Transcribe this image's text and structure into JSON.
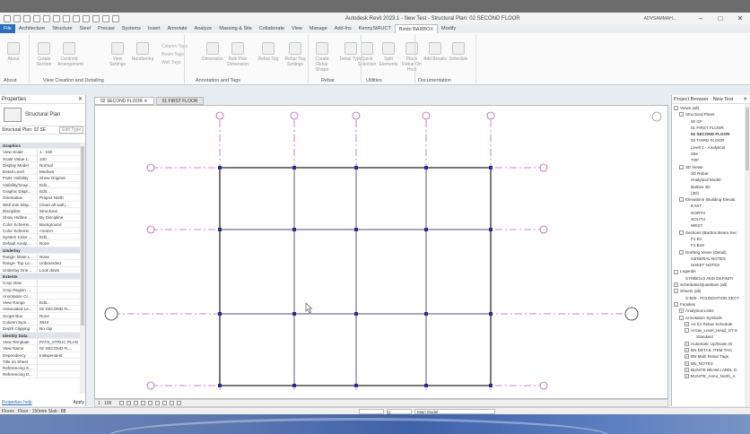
{
  "window": {
    "title": "Autodesk Revit 2023.1 - New Test - Structural Plan: 02 SECOND FLOOR",
    "user": "ADVSAMMAH..."
  },
  "tabs": [
    "File",
    "Architecture",
    "Structure",
    "Steel",
    "Precast",
    "Systems",
    "Insert",
    "Annotate",
    "Analyze",
    "Massing & Site",
    "Collaborate",
    "View",
    "Manage",
    "Add-Ins",
    "KennyStRUCT",
    "Bimbi BARBOX",
    "Modify"
  ],
  "ribbon": {
    "buttons": [
      "About",
      "Create Section",
      "Centroid Arrangement",
      "View Settings",
      "Numbering",
      "Dimension",
      "Bulk Plan Dimension",
      "Rebar Tag",
      "Rebar Tag Settings",
      "Create Rebar Shape",
      "Detail Type",
      "Quick Selection",
      "Split Elements",
      "Place Rebar On Host",
      "Add Breaks",
      "Schedule"
    ],
    "small": [
      "Column Tags",
      "Beam Tags",
      "Wall Tags"
    ],
    "panels": [
      "About",
      "View Creation and Detailing",
      "Annotation and Tags",
      "Rebar",
      "Utilities",
      "Documentation"
    ]
  },
  "properties": {
    "title": "Properties",
    "type": "Structural Plan",
    "selector": "Structural Plan: 02 SE",
    "edit_type": "Edit Type",
    "rows": [
      {
        "group": "Graphics"
      },
      {
        "k": "View Scale",
        "v": "1 : 100"
      },
      {
        "k": "Scale Value 1:",
        "v": "100"
      },
      {
        "k": "Display Model",
        "v": "Normal"
      },
      {
        "k": "Detail Level",
        "v": "Medium"
      },
      {
        "k": "Parts Visibility",
        "v": "Show Original"
      },
      {
        "k": "Visibility/Grap...",
        "v": "Edit..."
      },
      {
        "k": "Graphic Displ...",
        "v": "Edit..."
      },
      {
        "k": "Orientation",
        "v": "Project North"
      },
      {
        "k": "Wall Join Disp...",
        "v": "Clean all wall j..."
      },
      {
        "k": "Discipline",
        "v": "Structural"
      },
      {
        "k": "Show Hidden ...",
        "v": "By Discipline"
      },
      {
        "k": "Color Scheme...",
        "v": "Background"
      },
      {
        "k": "Color Scheme",
        "v": "<none>"
      },
      {
        "k": "System Color ...",
        "v": "Edit..."
      },
      {
        "k": "Default Analy...",
        "v": "None"
      },
      {
        "group": "Underlay"
      },
      {
        "k": "Range: Base L...",
        "v": "None"
      },
      {
        "k": "Range: Top Le...",
        "v": "Unbounded"
      },
      {
        "k": "Underlay Orie...",
        "v": "Look down"
      },
      {
        "group": "Extents"
      },
      {
        "k": "Crop View",
        "v": ""
      },
      {
        "k": "Crop Region ...",
        "v": ""
      },
      {
        "k": "Annotation Cr...",
        "v": ""
      },
      {
        "k": "View Range",
        "v": "Edit..."
      },
      {
        "k": "Associated Le...",
        "v": "02 SECOND FL..."
      },
      {
        "k": "Scope Box",
        "v": "None"
      },
      {
        "k": "Column Sym...",
        "v": "3843"
      },
      {
        "k": "Depth Clipping",
        "v": "No clip"
      },
      {
        "group": "Identity Data"
      },
      {
        "k": "View Template",
        "v": "PATS_STRUC PLAN"
      },
      {
        "k": "View Name",
        "v": "02 SECOND FL..."
      },
      {
        "k": "Dependency",
        "v": "Independent"
      },
      {
        "k": "Title on Sheet",
        "v": ""
      },
      {
        "k": "Referencing S...",
        "v": ""
      },
      {
        "k": "Referencing D...",
        "v": ""
      }
    ],
    "help": "Properties help",
    "apply": "Apply"
  },
  "view_tabs": [
    "02 SECOND FLOOR",
    "01 FIRST FLOOR"
  ],
  "view_strip": {
    "scale": "1 : 100"
  },
  "project_browser": {
    "title": "Project Browser - New Test",
    "items": [
      {
        "lvl": 0,
        "ex": "-",
        "t": "Views (all)"
      },
      {
        "lvl": 1,
        "ex": "-",
        "t": "Structural Plans"
      },
      {
        "lvl": 2,
        "ex": "",
        "t": "00 GF"
      },
      {
        "lvl": 2,
        "ex": "",
        "t": "01 FIRST FLOOR"
      },
      {
        "lvl": 2,
        "ex": "",
        "t": "02 SECOND FLOOR",
        "bold": true
      },
      {
        "lvl": 2,
        "ex": "",
        "t": "03 THIRD FLOOR"
      },
      {
        "lvl": 2,
        "ex": "",
        "t": "Level 1 - Analytical"
      },
      {
        "lvl": 2,
        "ex": "",
        "t": "Site"
      },
      {
        "lvl": 2,
        "ex": "",
        "t": "TOF"
      },
      {
        "lvl": 1,
        "ex": "-",
        "t": "3D Views"
      },
      {
        "lvl": 2,
        "ex": "",
        "t": "3D Rebar"
      },
      {
        "lvl": 2,
        "ex": "",
        "t": "Analytical Model"
      },
      {
        "lvl": 2,
        "ex": "",
        "t": "Barbox 3D"
      },
      {
        "lvl": 2,
        "ex": "",
        "t": "{3D}"
      },
      {
        "lvl": 1,
        "ex": "-",
        "t": "Elevations (Building Elevati"
      },
      {
        "lvl": 2,
        "ex": "",
        "t": "EAST"
      },
      {
        "lvl": 2,
        "ex": "",
        "t": "NORTH"
      },
      {
        "lvl": 2,
        "ex": "",
        "t": "SOUTH"
      },
      {
        "lvl": 2,
        "ex": "",
        "t": "WEST"
      },
      {
        "lvl": 1,
        "ex": "-",
        "t": "Sections (Barbox Beam Sec"
      },
      {
        "lvl": 2,
        "ex": "",
        "t": "F1.B1"
      },
      {
        "lvl": 2,
        "ex": "",
        "t": "F1.B18"
      },
      {
        "lvl": 1,
        "ex": "-",
        "t": "Drafting Views (Detail)"
      },
      {
        "lvl": 2,
        "ex": "",
        "t": "GENERAL NOTES"
      },
      {
        "lvl": 2,
        "ex": "",
        "t": "SHEET NOTES"
      },
      {
        "lvl": 0,
        "ex": "-",
        "t": "Legends"
      },
      {
        "lvl": 1,
        "ex": "",
        "t": "SYMBOLS AND DEFINITI"
      },
      {
        "lvl": 0,
        "ex": "+",
        "t": "Schedules/Quantities (all)"
      },
      {
        "lvl": 0,
        "ex": "-",
        "t": "Sheets (all)"
      },
      {
        "lvl": 1,
        "ex": "",
        "t": "S-500 - FOUNDATION SECT"
      },
      {
        "lvl": 0,
        "ex": "-",
        "t": "Families"
      },
      {
        "lvl": 1,
        "ex": "+",
        "t": "Analytical Links"
      },
      {
        "lvl": 1,
        "ex": "-",
        "t": "Annotation Symbols"
      },
      {
        "lvl": 2,
        "ex": "+",
        "t": "A4 for Rebar Schedule"
      },
      {
        "lvl": 2,
        "ex": "-",
        "t": "Arrow_Level_Head_ST-S"
      },
      {
        "lvl": 3,
        "ex": "",
        "t": "Standard"
      },
      {
        "lvl": 2,
        "ex": "+",
        "t": "Automatic Up/Down Di"
      },
      {
        "lvl": 2,
        "ex": "+",
        "t": "BN DETAIL ITEM TAG"
      },
      {
        "lvl": 2,
        "ex": "+",
        "t": "BN Multi Rebar Tags"
      },
      {
        "lvl": 2,
        "ex": "+",
        "t": "BN_NOTES"
      },
      {
        "lvl": 2,
        "ex": "+",
        "t": "BUNITE BEAM LABEL D"
      },
      {
        "lvl": 2,
        "ex": "+",
        "t": "BUNITE_Anno_North_A"
      }
    ]
  },
  "status": {
    "left": "Floors : Floor : 150mm Slab : 88",
    "model": "Main Model",
    "zero": "0"
  }
}
